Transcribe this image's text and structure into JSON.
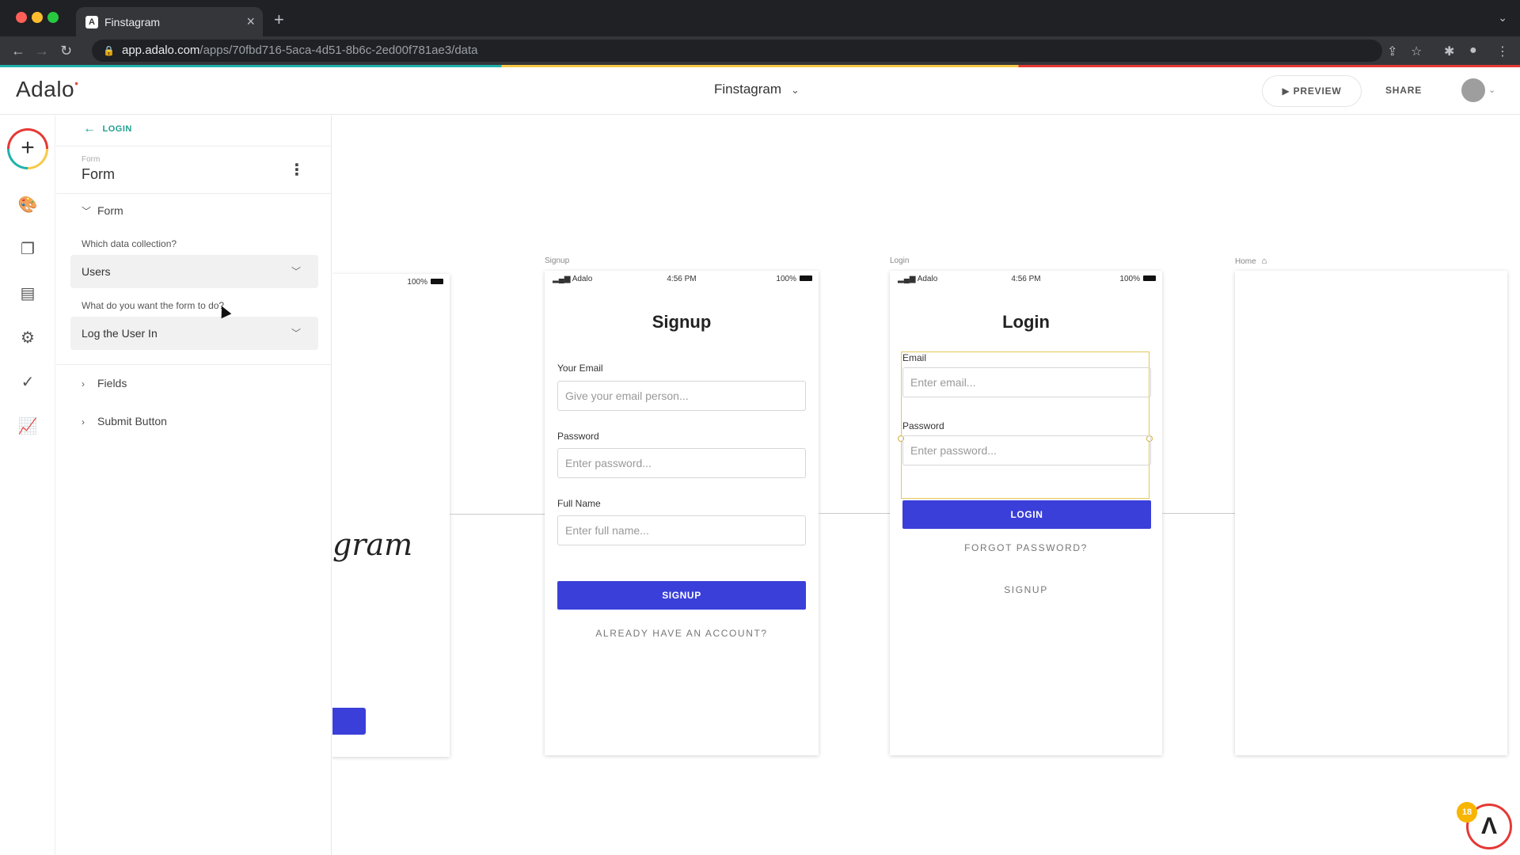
{
  "browser": {
    "tab_title": "Finstagram",
    "tab_favicon": "A",
    "new_tab": "+",
    "url_host": "app.adalo.com",
    "url_path": "/apps/70fbd716-5aca-4d51-8b6c-2ed00f781ae3/data"
  },
  "header": {
    "logo": "Adalo",
    "app_name": "Finstagram",
    "preview_label": "PREVIEW",
    "share_label": "SHARE"
  },
  "panel": {
    "back_label": "LOGIN",
    "component_type": "Form",
    "component_name": "Form",
    "section_form": "Form",
    "collection_label": "Which data collection?",
    "collection_value": "Users",
    "action_label": "What do you want the form to do?",
    "action_value": "Log the User In",
    "section_fields": "Fields",
    "section_submit": "Submit Button"
  },
  "canvas": {
    "partial_screen": {
      "battery": "100%",
      "logo_fragment": "gram"
    },
    "signup": {
      "label": "Signup",
      "carrier": "Adalo",
      "time": "4:56 PM",
      "battery": "100%",
      "title": "Signup",
      "email_label": "Your Email",
      "email_placeholder": "Give your email person...",
      "password_label": "Password",
      "password_placeholder": "Enter password...",
      "name_label": "Full Name",
      "name_placeholder": "Enter full name...",
      "button": "SIGNUP",
      "link": "ALREADY HAVE AN ACCOUNT?"
    },
    "login": {
      "label": "Login",
      "carrier": "Adalo",
      "time": "4:56 PM",
      "battery": "100%",
      "title": "Login",
      "email_label": "Email",
      "email_placeholder": "Enter email...",
      "password_label": "Password",
      "password_placeholder": "Enter password...",
      "button": "LOGIN",
      "forgot": "FORGOT PASSWORD?",
      "signup_link": "SIGNUP"
    },
    "home": {
      "label": "Home"
    }
  },
  "help_badge_count": "18",
  "colors": {
    "primary_button": "#3a3fd9",
    "accent_teal": "#20a08f",
    "selection": "#e6c65a"
  }
}
